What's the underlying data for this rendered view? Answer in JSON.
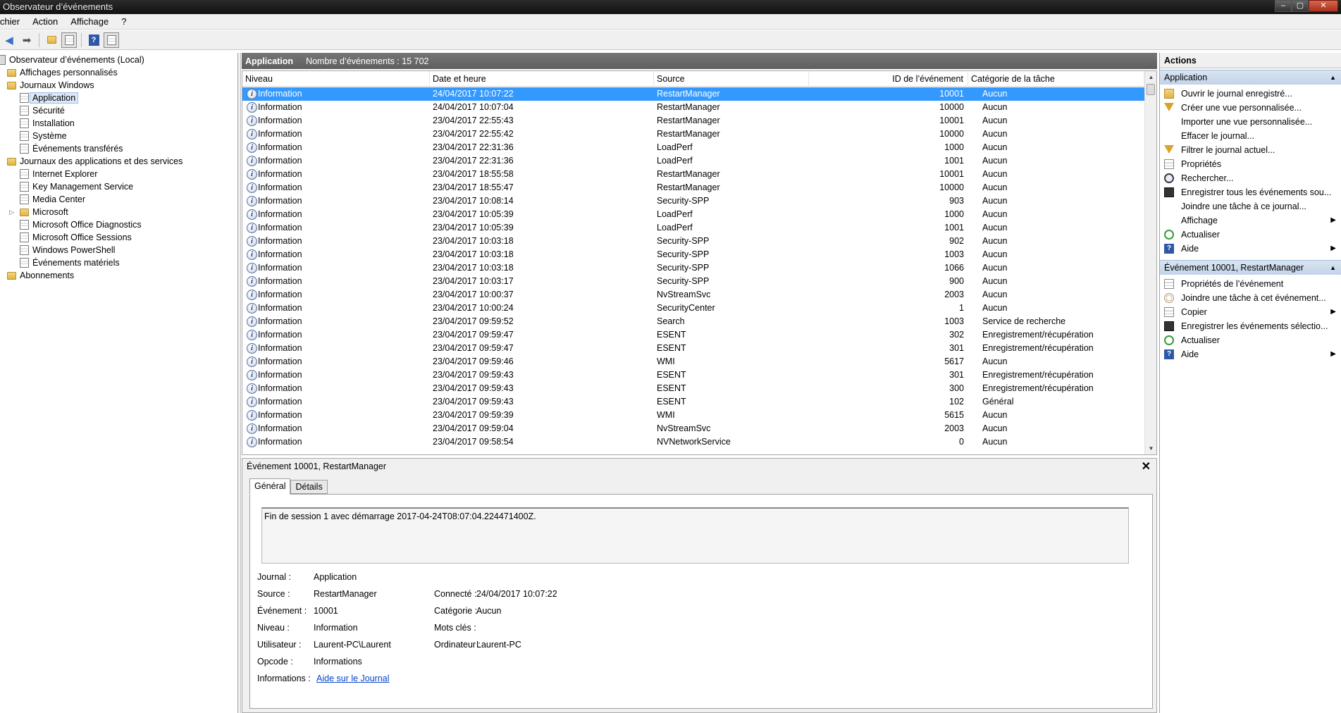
{
  "window": {
    "title": "Observateur d’événements",
    "buttons": [
      "–",
      "▢",
      "✕"
    ]
  },
  "menu": [
    "ichier",
    "Action",
    "Affichage",
    "?"
  ],
  "tree": {
    "root": "Observateur d’événements (Local)",
    "items": [
      {
        "label": "Affichages personnalisés",
        "level": 1,
        "icon": "folder"
      },
      {
        "label": "Journaux Windows",
        "level": 1,
        "icon": "folder"
      },
      {
        "label": "Application",
        "level": 2,
        "icon": "log",
        "selected": true
      },
      {
        "label": "Sécurité",
        "level": 2,
        "icon": "log"
      },
      {
        "label": "Installation",
        "level": 2,
        "icon": "log"
      },
      {
        "label": "Système",
        "level": 2,
        "icon": "log"
      },
      {
        "label": "Événements transférés",
        "level": 2,
        "icon": "log"
      },
      {
        "label": "Journaux des applications et des services",
        "level": 1,
        "icon": "folder"
      },
      {
        "label": "Internet Explorer",
        "level": 2,
        "icon": "log"
      },
      {
        "label": "Key Management Service",
        "level": 2,
        "icon": "log"
      },
      {
        "label": "Media Center",
        "level": 2,
        "icon": "log"
      },
      {
        "label": "Microsoft",
        "level": 2,
        "icon": "folder",
        "expandable": true
      },
      {
        "label": "Microsoft Office Diagnostics",
        "level": 2,
        "icon": "log"
      },
      {
        "label": "Microsoft Office Sessions",
        "level": 2,
        "icon": "log"
      },
      {
        "label": "Windows PowerShell",
        "level": 2,
        "icon": "log"
      },
      {
        "label": "Événements matériels",
        "level": 2,
        "icon": "log"
      },
      {
        "label": "Abonnements",
        "level": 1,
        "icon": "folder"
      }
    ]
  },
  "center": {
    "name": "Application",
    "count": "Nombre d’événements : 15 702",
    "columns": [
      "Niveau",
      "Date et heure",
      "Source",
      "ID de l’événement",
      "Catégorie de la tâche"
    ],
    "rows": [
      [
        "Information",
        "24/04/2017 10:07:22",
        "RestartManager",
        "10001",
        "Aucun"
      ],
      [
        "Information",
        "24/04/2017 10:07:04",
        "RestartManager",
        "10000",
        "Aucun"
      ],
      [
        "Information",
        "23/04/2017 22:55:43",
        "RestartManager",
        "10001",
        "Aucun"
      ],
      [
        "Information",
        "23/04/2017 22:55:42",
        "RestartManager",
        "10000",
        "Aucun"
      ],
      [
        "Information",
        "23/04/2017 22:31:36",
        "LoadPerf",
        "1000",
        "Aucun"
      ],
      [
        "Information",
        "23/04/2017 22:31:36",
        "LoadPerf",
        "1001",
        "Aucun"
      ],
      [
        "Information",
        "23/04/2017 18:55:58",
        "RestartManager",
        "10001",
        "Aucun"
      ],
      [
        "Information",
        "23/04/2017 18:55:47",
        "RestartManager",
        "10000",
        "Aucun"
      ],
      [
        "Information",
        "23/04/2017 10:08:14",
        "Security-SPP",
        "903",
        "Aucun"
      ],
      [
        "Information",
        "23/04/2017 10:05:39",
        "LoadPerf",
        "1000",
        "Aucun"
      ],
      [
        "Information",
        "23/04/2017 10:05:39",
        "LoadPerf",
        "1001",
        "Aucun"
      ],
      [
        "Information",
        "23/04/2017 10:03:18",
        "Security-SPP",
        "902",
        "Aucun"
      ],
      [
        "Information",
        "23/04/2017 10:03:18",
        "Security-SPP",
        "1003",
        "Aucun"
      ],
      [
        "Information",
        "23/04/2017 10:03:18",
        "Security-SPP",
        "1066",
        "Aucun"
      ],
      [
        "Information",
        "23/04/2017 10:03:17",
        "Security-SPP",
        "900",
        "Aucun"
      ],
      [
        "Information",
        "23/04/2017 10:00:37",
        "NvStreamSvc",
        "2003",
        "Aucun"
      ],
      [
        "Information",
        "23/04/2017 10:00:24",
        "SecurityCenter",
        "1",
        "Aucun"
      ],
      [
        "Information",
        "23/04/2017 09:59:52",
        "Search",
        "1003",
        "Service de recherche"
      ],
      [
        "Information",
        "23/04/2017 09:59:47",
        "ESENT",
        "302",
        "Enregistrement/récupération"
      ],
      [
        "Information",
        "23/04/2017 09:59:47",
        "ESENT",
        "301",
        "Enregistrement/récupération"
      ],
      [
        "Information",
        "23/04/2017 09:59:46",
        "WMI",
        "5617",
        "Aucun"
      ],
      [
        "Information",
        "23/04/2017 09:59:43",
        "ESENT",
        "301",
        "Enregistrement/récupération"
      ],
      [
        "Information",
        "23/04/2017 09:59:43",
        "ESENT",
        "300",
        "Enregistrement/récupération"
      ],
      [
        "Information",
        "23/04/2017 09:59:43",
        "ESENT",
        "102",
        "Général"
      ],
      [
        "Information",
        "23/04/2017 09:59:39",
        "WMI",
        "5615",
        "Aucun"
      ],
      [
        "Information",
        "23/04/2017 09:59:04",
        "NvStreamSvc",
        "2003",
        "Aucun"
      ],
      [
        "Information",
        "23/04/2017 09:58:54",
        "NVNetworkService",
        "0",
        "Aucun"
      ]
    ],
    "selected_row": 0
  },
  "detail": {
    "title": "Événement 10001, RestartManager",
    "close": "✕",
    "tabs": [
      "Général",
      "Détails"
    ],
    "message": "Fin de session 1 avec démarrage 2017-04-24T08:07:04.224471400Z.",
    "fields_left": [
      {
        "label": "Journal :",
        "value": "Application"
      },
      {
        "label": "Source :",
        "value": "RestartManager"
      },
      {
        "label": "Événement :",
        "value": "10001"
      },
      {
        "label": "Niveau :",
        "value": "Information"
      },
      {
        "label": "Utilisateur :",
        "value": "Laurent-PC\\Laurent"
      },
      {
        "label": "Opcode :",
        "value": "Informations"
      },
      {
        "label": "Informations :",
        "value": "Aide sur le Journal",
        "link": true
      }
    ],
    "fields_right": [
      {
        "label": "Connecté :",
        "value": "24/04/2017 10:07:22"
      },
      {
        "label": "Catégorie :",
        "value": "Aucun"
      },
      {
        "label": "Mots clés :",
        "value": ""
      },
      {
        "label": "Ordinateur :",
        "value": "Laurent-PC"
      }
    ]
  },
  "actions": {
    "header": "Actions",
    "sections": [
      {
        "title": "Application",
        "items": [
          {
            "label": "Ouvrir le journal enregistré...",
            "icon": "folder"
          },
          {
            "label": "Créer une vue personnalisée...",
            "icon": "filter"
          },
          {
            "label": "Importer une vue personnalisée...",
            "icon": ""
          },
          {
            "label": "Effacer le journal...",
            "icon": ""
          },
          {
            "label": "Filtrer le journal actuel...",
            "icon": "filter"
          },
          {
            "label": "Propriétés",
            "icon": "doc"
          },
          {
            "label": "Rechercher...",
            "icon": "find"
          },
          {
            "label": "Enregistrer tous les événements sou...",
            "icon": "save"
          },
          {
            "label": "Joindre une tâche à ce journal...",
            "icon": ""
          },
          {
            "label": "Affichage",
            "icon": "",
            "submenu": true
          },
          {
            "label": "Actualiser",
            "icon": "refresh"
          },
          {
            "label": "Aide",
            "icon": "help",
            "submenu": true
          }
        ]
      },
      {
        "title": "Événement 10001, RestartManager",
        "items": [
          {
            "label": "Propriétés de l’événement",
            "icon": "doc"
          },
          {
            "label": "Joindre une tâche à cet événement...",
            "icon": "task"
          },
          {
            "label": "Copier",
            "icon": "doc",
            "submenu": true
          },
          {
            "label": "Enregistrer les événements sélectio...",
            "icon": "save"
          },
          {
            "label": "Actualiser",
            "icon": "refresh"
          },
          {
            "label": "Aide",
            "icon": "help",
            "submenu": true
          }
        ]
      }
    ]
  }
}
